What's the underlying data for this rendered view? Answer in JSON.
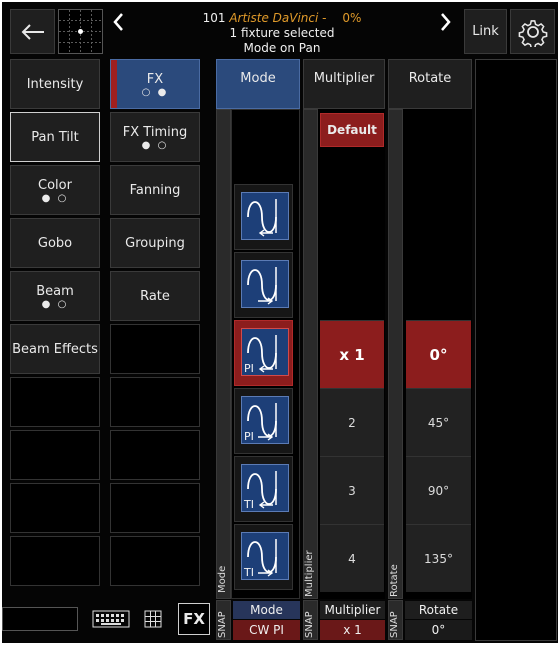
{
  "header": {
    "fixture_number": "101",
    "fixture_name": "Artiste DaVinci",
    "dash": "-",
    "percent": "0%",
    "selection_line": "1 fixture selected",
    "mode_line": "Mode on Pan",
    "link_label": "Link",
    "icons": [
      "back-arrow-icon",
      "position-grid-icon",
      "chevron-left-icon",
      "chevron-right-icon",
      "gear-icon"
    ]
  },
  "left_buttons": [
    {
      "label": "Intensity",
      "dots": ""
    },
    {
      "label": "FX",
      "dots": "○ ●"
    },
    {
      "label": "Pan Tilt",
      "dots": ""
    },
    {
      "label": "FX Timing",
      "dots": "● ○"
    },
    {
      "label": "Color",
      "dots": "● ○"
    },
    {
      "label": "Fanning",
      "dots": ""
    },
    {
      "label": "Gobo",
      "dots": ""
    },
    {
      "label": "Grouping",
      "dots": ""
    },
    {
      "label": "Beam",
      "dots": "● ○"
    },
    {
      "label": "Rate",
      "dots": ""
    },
    {
      "label": "Beam Effects",
      "dots": ""
    }
  ],
  "columns": {
    "mode": {
      "header": "Mode",
      "side_label": "Mode",
      "snap": "SNAP",
      "foot_title": "Mode",
      "foot_value": "CW PI"
    },
    "multiplier": {
      "header": "Multiplier",
      "default_label": "Default",
      "side_label": "Multiplier",
      "snap": "SNAP",
      "foot_title": "Multiplier",
      "foot_value": "x 1"
    },
    "rotate": {
      "header": "Rotate",
      "side_label": "Rotate",
      "snap": "SNAP",
      "foot_title": "Rotate",
      "foot_value": "0°"
    }
  },
  "mode_tiles": [
    {
      "label": "",
      "arrow": "left"
    },
    {
      "label": "",
      "arrow": "right"
    },
    {
      "label": "PI",
      "arrow": "left"
    },
    {
      "label": "PI",
      "arrow": "right"
    },
    {
      "label": "TI",
      "arrow": "left"
    },
    {
      "label": "TI",
      "arrow": "right"
    }
  ],
  "multiplier_values": [
    "x 1",
    "2",
    "3",
    "4"
  ],
  "rotate_values": [
    "0°",
    "45°",
    "90°",
    "135°"
  ],
  "bottom_toolbar": {
    "fx_label": "FX",
    "icons": [
      "keyboard-icon",
      "keypad-icon"
    ]
  },
  "colors": {
    "accent_blue": "#2b4a7c",
    "selected_red": "#8c1d1d",
    "orange": "#e09a2a"
  }
}
